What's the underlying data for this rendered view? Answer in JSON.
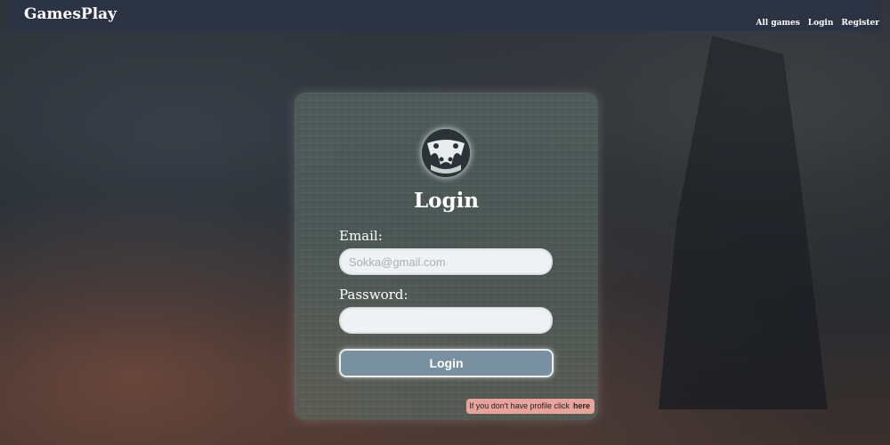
{
  "header": {
    "brand": "GamesPlay",
    "nav": [
      {
        "label": "All games"
      },
      {
        "label": "Login"
      },
      {
        "label": "Register"
      }
    ]
  },
  "form": {
    "logo_icon": "gamepad-badge-icon",
    "title": "Login",
    "email_label": "Email:",
    "email_placeholder": "Sokka@gmail.com",
    "email_value": "",
    "password_label": "Password:",
    "password_value": "",
    "submit_label": "Login",
    "register_hint": "If you don't have profile click",
    "register_link": "here"
  },
  "colors": {
    "header_bg": "#2c3444",
    "button_bg": "#7990a0",
    "hint_bg": "#e8a49a"
  }
}
